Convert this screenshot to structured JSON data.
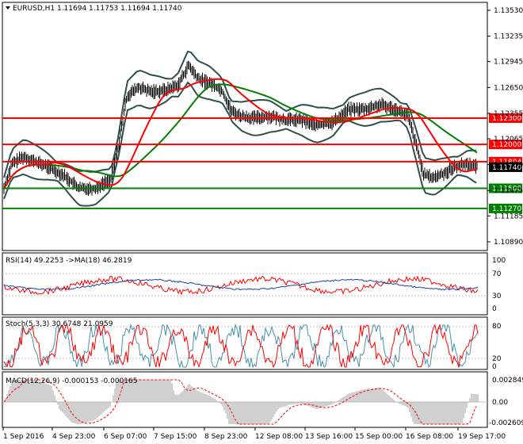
{
  "header": {
    "symbol_line": "EURUSD,H1  1.11694 1.11753 1.11694 1.11740"
  },
  "price_axis": {
    "ticks": [
      {
        "v": 1.1353,
        "t": "1.13530"
      },
      {
        "v": 1.13235,
        "t": "1.13235"
      },
      {
        "v": 1.12945,
        "t": "1.12945"
      },
      {
        "v": 1.1265,
        "t": "1.12650"
      },
      {
        "v": 1.12355,
        "t": "1.12355"
      },
      {
        "v": 1.12065,
        "t": "1.12065"
      },
      {
        "v": 1.1177,
        "t": "1.11770"
      },
      {
        "v": 1.11475,
        "t": "1.11475"
      },
      {
        "v": 1.11185,
        "t": "1.11185"
      },
      {
        "v": 1.1089,
        "t": "1.10890"
      }
    ],
    "range": [
      1.1079,
      1.1362
    ]
  },
  "levels": [
    {
      "v": 1.123,
      "t": "1.12300",
      "color": "#ff0000"
    },
    {
      "v": 1.12,
      "t": "1.12000",
      "color": "#ff0000"
    },
    {
      "v": 1.11804,
      "t": "1.11804",
      "color": "#ff0000"
    },
    {
      "v": 1.115,
      "t": "1.11500",
      "color": "#008000"
    },
    {
      "v": 1.1127,
      "t": "1.11270",
      "color": "#008000"
    }
  ],
  "current_price": {
    "v": 1.1174,
    "t": "1.11740"
  },
  "rsi": {
    "label": "RSI(14) 49.2253  ->MA(18) 46.2819",
    "ticks": [
      "100",
      "70",
      "30",
      "0"
    ]
  },
  "stoch": {
    "label": "Stoch(5,3,3) 30.6748 21.0959",
    "ticks": [
      "80",
      "20",
      "0"
    ]
  },
  "macd": {
    "label": "MACD(12,26,9) -0.000153 -0.000165",
    "ticks": [
      "0.002849",
      "0.00",
      "-0.002609"
    ]
  },
  "time_axis": [
    "1 Sep 2016",
    "4 Sep 23:00",
    "6 Sep 07:00",
    "7 Sep 15:00",
    "8 Sep 23:00",
    "12 Sep 08:00",
    "13 Sep 16:00",
    "15 Sep 00:00",
    "16 Sep 08:00",
    "19 Sep 17:00"
  ],
  "colors": {
    "red_level": "#ff0000",
    "green_level": "#008000",
    "candle": "#000000",
    "bollinger": "#2f4f4f",
    "ma_fast": "#008000",
    "ma_slow": "#ff0000",
    "osc_blue": "#1c3fa0",
    "osc_red": "#ff0000"
  }
}
